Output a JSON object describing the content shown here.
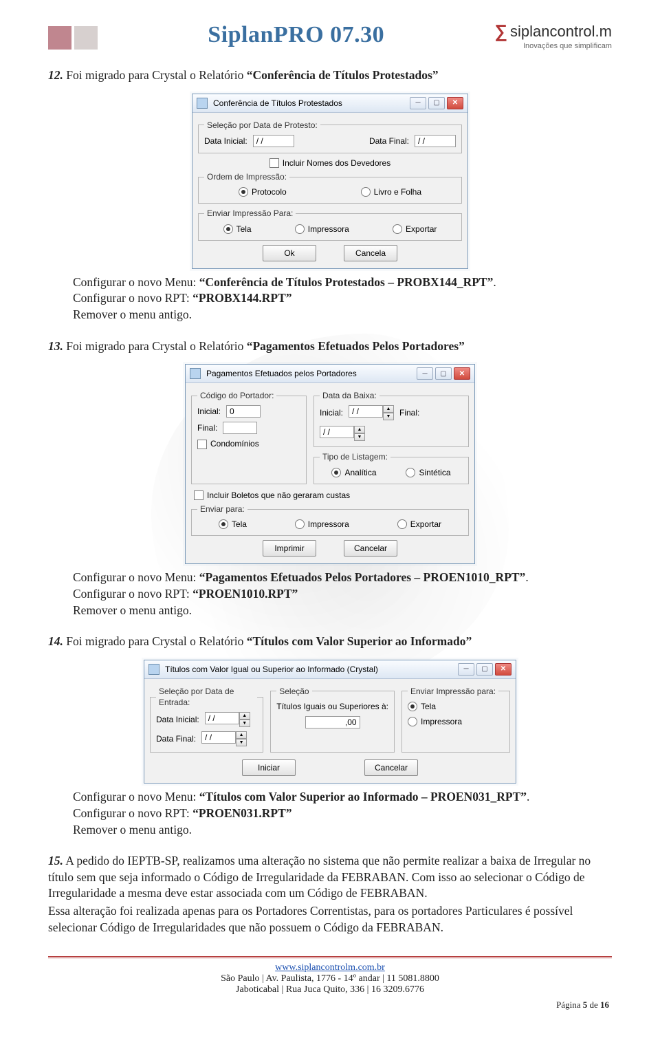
{
  "header": {
    "title": "SiplanPRO 07.30",
    "brand": "siplancontrol.m",
    "tagline": "Inovações que simplificam"
  },
  "items": [
    {
      "num": "12.",
      "text_a": "Foi migrado para Crystal o Relatório ",
      "text_b": "“Conferência de Títulos Protestados”",
      "cfg_menu_a": "Configurar o novo Menu: ",
      "cfg_menu_b": "“Conferência de Títulos Protestados – PROBX144_RPT”",
      "cfg_rpt_a": "Configurar o novo RPT: ",
      "cfg_rpt_b": "“PROBX144.RPT”",
      "remove": "Remover o menu antigo."
    },
    {
      "num": "13.",
      "text_a": "Foi migrado para Crystal o Relatório ",
      "text_b": "“Pagamentos Efetuados Pelos Portadores”",
      "cfg_menu_a": "Configurar o novo Menu: ",
      "cfg_menu_b": "“Pagamentos Efetuados Pelos Portadores – PROEN1010_RPT”",
      "cfg_rpt_a": "Configurar o novo RPT: ",
      "cfg_rpt_b": "“PROEN1010.RPT”",
      "remove": "Remover o menu antigo."
    },
    {
      "num": "14.",
      "text_a": "Foi migrado para Crystal o Relatório ",
      "text_b": "“Títulos com Valor Superior ao Informado”",
      "cfg_menu_a": "Configurar o novo Menu: ",
      "cfg_menu_b": "“Títulos com Valor Superior ao Informado – PROEN031_RPT”",
      "cfg_rpt_a": "Configurar o novo RPT: ",
      "cfg_rpt_b": "“PROEN031.RPT”",
      "remove": "Remover o menu antigo."
    }
  ],
  "item15": {
    "num": "15.",
    "p1": "A pedido do IEPTB-SP, realizamos uma alteração no sistema que não permite realizar a baixa de Irregular no título sem que seja informado o Código de Irregularidade da FEBRABAN. Com isso ao selecionar o Código de Irregularidade a mesma deve estar associada com um Código de FEBRABAN.",
    "p2": "Essa alteração foi realizada apenas para os Portadores Correntistas, para os portadores Particulares é possível selecionar Código de Irregularidades que não possuem o Código da FEBRABAN."
  },
  "dlg1": {
    "title": "Conferência de Títulos Protestados",
    "grp1": "Seleção por Data de Protesto:",
    "di": "Data Inicial:",
    "df": "Data Final:",
    "date": "/ /",
    "chk": "Incluir Nomes dos Devedores",
    "grp2": "Ordem de Impressão:",
    "r1": "Protocolo",
    "r2": "Livro e Folha",
    "grp3": "Enviar Impressão Para:",
    "r3": "Tela",
    "r4": "Impressora",
    "r5": "Exportar",
    "ok": "Ok",
    "cancel": "Cancela"
  },
  "dlg2": {
    "title": "Pagamentos Efetuados pelos Portadores",
    "grp1": "Código do Portador:",
    "ini": "Inicial:",
    "ini_v": "0",
    "fin": "Final:",
    "chkCond": "Condomínios",
    "grp2": "Data da Baixa:",
    "date": "/ /",
    "grp3": "Tipo de Listagem:",
    "r1": "Analítica",
    "r2": "Sintética",
    "chkBol": "Incluir Boletos que não geraram custas",
    "grp4": "Enviar para:",
    "r3": "Tela",
    "r4": "Impressora",
    "r5": "Exportar",
    "ok": "Imprimir",
    "cancel": "Cancelar"
  },
  "dlg3": {
    "title": "Títulos com Valor Igual ou Superior ao Informado  (Crystal)",
    "grp1": "Seleção por Data de Entrada:",
    "di": "Data Inicial:",
    "df": "Data Final:",
    "date": "/ /",
    "grp2": "Seleção",
    "sel_lbl": "Títulos Iguais ou Superiores à:",
    "sel_val": ",00",
    "grp3": "Enviar Impressão para:",
    "r1": "Tela",
    "r2": "Impressora",
    "ok": "Iniciar",
    "cancel": "Cancelar"
  },
  "footer": {
    "url": "www.siplancontrolm.com.br",
    "line1": "São Paulo | Av. Paulista, 1776 - 14º andar | 11 5081.8800",
    "line2": "Jaboticabal | Rua Juca Quito, 336 | 16 3209.6776",
    "page": "Página 5 de 16"
  }
}
